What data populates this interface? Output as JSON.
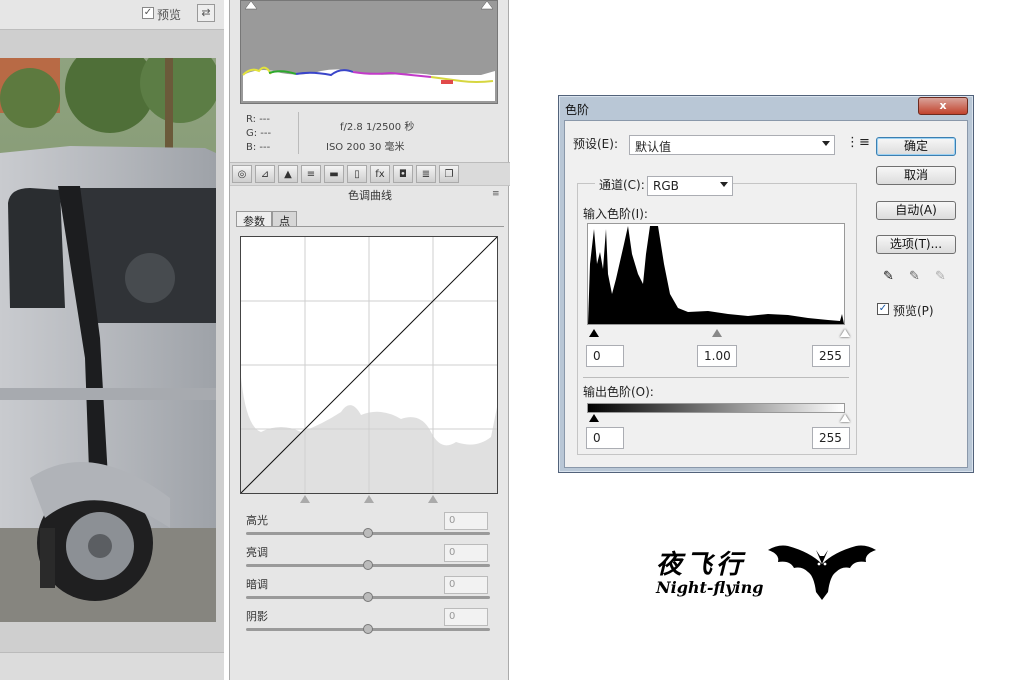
{
  "left_panel": {
    "preview_label": "预览",
    "preview_checked": true
  },
  "acr": {
    "readout": {
      "r": "R: ---",
      "g": "G: ---",
      "b": "B: ---",
      "exposure": "f/2.8   1/2500 秒",
      "iso": "ISO 200   30 毫米"
    },
    "toolbar_icons": [
      "aperture-icon",
      "tone-curve-icon",
      "detail-icon",
      "hsl-icon",
      "split-toning-icon",
      "lens-icon",
      "fx-icon",
      "camera-calibration-icon",
      "presets-icon",
      "snapshots-icon"
    ],
    "toolbar_glyphs": [
      "◎",
      "⊿",
      "▲",
      "≡",
      "▬",
      "▯",
      "fx",
      "◘",
      "≣",
      "❐"
    ],
    "section_title": "色调曲线",
    "tabs": [
      "参数",
      "点"
    ],
    "sliders": [
      {
        "label": "高光",
        "value": "0"
      },
      {
        "label": "亮调",
        "value": "0"
      },
      {
        "label": "暗调",
        "value": "0"
      },
      {
        "label": "阴影",
        "value": "0"
      }
    ]
  },
  "levels_dialog": {
    "title": "色阶",
    "close_glyph": "x",
    "preset_label": "预设(E):",
    "preset_value": "默认值",
    "channel_label": "通道(C):",
    "channel_value": "RGB",
    "input_label": "输入色阶(I):",
    "input_values": {
      "black": "0",
      "gamma": "1.00",
      "white": "255"
    },
    "output_label": "输出色阶(O):",
    "output_values": {
      "black": "0",
      "white": "255"
    },
    "buttons": {
      "ok": "确定",
      "cancel": "取消",
      "auto": "自动(A)",
      "options": "选项(T)..."
    },
    "preview_label": "预览(P)",
    "preview_checked": true
  },
  "watermark": {
    "cn": "夜飞行",
    "en": "Night-flying"
  }
}
